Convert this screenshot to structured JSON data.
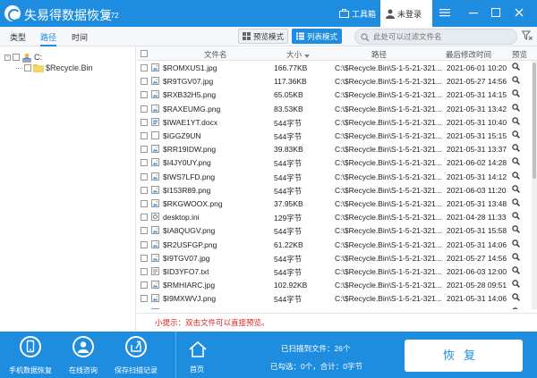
{
  "app": {
    "title": "失易得数据恢复",
    "version": "6.72",
    "toolbox_label": "工具箱",
    "login_label": "未登录"
  },
  "tabs": [
    {
      "label": "类型",
      "active": false
    },
    {
      "label": "路径",
      "active": true
    },
    {
      "label": "时间",
      "active": false
    }
  ],
  "view_modes": {
    "thumbnail": "预览模式",
    "list": "列表模式",
    "selected": "list"
  },
  "search": {
    "placeholder": "此处可以过滤文件名"
  },
  "tree": [
    {
      "label": "C:",
      "icon": "user-drive-icon",
      "expanded": true
    },
    {
      "label": "$Recycle.Bin",
      "icon": "folder-icon"
    }
  ],
  "table": {
    "headers": {
      "name": "文件名",
      "size": "大小",
      "path": "路径",
      "date": "最后修改时间",
      "preview": "预览"
    },
    "rows": [
      {
        "name": "$ROMXUS1.jpg",
        "size": "166.77KB",
        "path": "C:\\$Recycle.Bin\\S-1-5-21-321...",
        "date": "2021-06-01  10:20",
        "icon": "image-file-icon"
      },
      {
        "name": "$R9TGV07.jpg",
        "size": "117.36KB",
        "path": "C:\\$Recycle.Bin\\S-1-5-21-321...",
        "date": "2021-05-27  14:56",
        "icon": "image-file-icon"
      },
      {
        "name": "$RXB32H5.png",
        "size": "65.05KB",
        "path": "C:\\$Recycle.Bin\\S-1-5-21-321...",
        "date": "2021-05-31  14:15",
        "icon": "image-file-icon"
      },
      {
        "name": "$RAXEUMG.png",
        "size": "83.53KB",
        "path": "C:\\$Recycle.Bin\\S-1-5-21-321...",
        "date": "2021-05-31  13:42",
        "icon": "image-file-icon"
      },
      {
        "name": "$IWAE1YT.docx",
        "size": "544字节",
        "path": "C:\\$Recycle.Bin\\S-1-5-21-321...",
        "date": "2021-05-31  10:40",
        "icon": "document-file-icon"
      },
      {
        "name": "$IGGZ9UN",
        "size": "544字节",
        "path": "C:\\$Recycle.Bin\\S-1-5-21-321...",
        "date": "2021-05-31  15:15",
        "icon": "blank-file-icon"
      },
      {
        "name": "$RR19IDW.png",
        "size": "39.83KB",
        "path": "C:\\$Recycle.Bin\\S-1-5-21-321...",
        "date": "2021-05-31  13:37",
        "icon": "image-file-icon"
      },
      {
        "name": "$I4JY0UY.png",
        "size": "544字节",
        "path": "C:\\$Recycle.Bin\\S-1-5-21-321...",
        "date": "2021-06-02  14:28",
        "icon": "image-file-icon"
      },
      {
        "name": "$IWS7LFD.png",
        "size": "544字节",
        "path": "C:\\$Recycle.Bin\\S-1-5-21-321...",
        "date": "2021-05-31  14:12",
        "icon": "image-file-icon"
      },
      {
        "name": "$I153R89.png",
        "size": "544字节",
        "path": "C:\\$Recycle.Bin\\S-1-5-21-321...",
        "date": "2021-06-03  11:20",
        "icon": "image-file-icon"
      },
      {
        "name": "$RKGWOOX.png",
        "size": "37.95KB",
        "path": "C:\\$Recycle.Bin\\S-1-5-21-321...",
        "date": "2021-05-31  13:48",
        "icon": "image-file-icon"
      },
      {
        "name": "desktop.ini",
        "size": "129字节",
        "path": "C:\\$Recycle.Bin\\S-1-5-21-321...",
        "date": "2021-04-28  11:33",
        "icon": "settings-file-icon"
      },
      {
        "name": "$IA8QUGV.png",
        "size": "544字节",
        "path": "C:\\$Recycle.Bin\\S-1-5-21-321...",
        "date": "2021-05-31  15:58",
        "icon": "image-file-icon"
      },
      {
        "name": "$R2USFGP.png",
        "size": "61.22KB",
        "path": "C:\\$Recycle.Bin\\S-1-5-21-321...",
        "date": "2021-05-31  14:06",
        "icon": "image-file-icon"
      },
      {
        "name": "$I9TGV07.jpg",
        "size": "544字节",
        "path": "C:\\$Recycle.Bin\\S-1-5-21-321...",
        "date": "2021-05-27  14:56",
        "icon": "image-file-icon"
      },
      {
        "name": "$ID3YFO7.txt",
        "size": "544字节",
        "path": "C:\\$Recycle.Bin\\S-1-5-21-321...",
        "date": "2021-06-03  12:00",
        "icon": "text-file-icon"
      },
      {
        "name": "$RMHIARC.jpg",
        "size": "102.92KB",
        "path": "C:\\$Recycle.Bin\\S-1-5-21-321...",
        "date": "2021-05-28  09:51",
        "icon": "image-file-icon"
      },
      {
        "name": "$I9MXWVJ.png",
        "size": "544字节",
        "path": "C:\\$Recycle.Bin\\S-1-5-21-321...",
        "date": "2021-05-31  14:06",
        "icon": "image-file-icon"
      },
      {
        "name": "$RB06JKG.jpg",
        "size": "2.46MB",
        "path": "C:\\$Recycle.Bin\\S-1-5-21-321...",
        "date": "2021-05-27  14:56",
        "icon": "image-file-icon"
      }
    ]
  },
  "tip": "小提示：双击文件可以直接预览。",
  "bottom": {
    "items": [
      {
        "label": "手机数据恢复",
        "icon": "phone-icon"
      },
      {
        "label": "在线咨询",
        "icon": "headset-user-icon"
      },
      {
        "label": "保存扫描记录",
        "icon": "export-icon"
      }
    ],
    "home_label": "首页",
    "scan_count": "已扫描到文件：26个",
    "selected_info": "已勾选：0个，合计：0字节",
    "recover_label": "恢复"
  },
  "colors": {
    "primary": "#1e8de0",
    "tip": "#e02020"
  }
}
